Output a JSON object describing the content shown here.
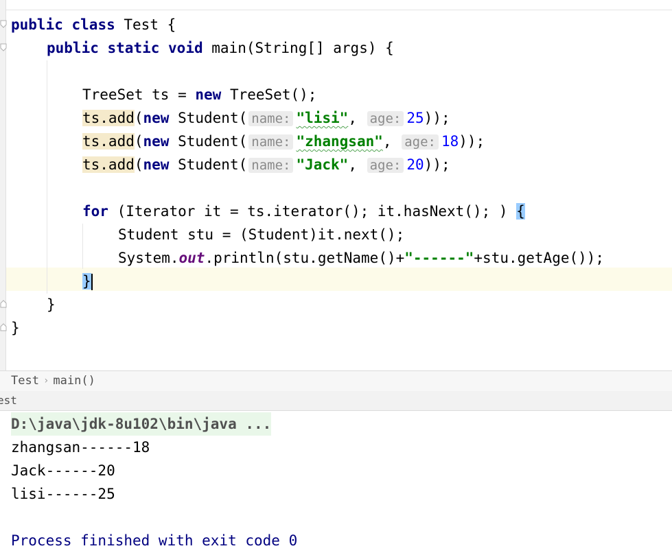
{
  "editor": {
    "l1": {
      "kw1": "public",
      "kw2": "class",
      "name": "Test {"
    },
    "l2": {
      "kw1": "public",
      "kw2": "static",
      "kw3": "void",
      "rest": "main(String[] args) {"
    },
    "l4": {
      "a": "TreeSet ts = ",
      "kw": "new",
      "b": " TreeSet();"
    },
    "adds": [
      {
        "ts": "ts.add",
        "open": "(",
        "kw": "new",
        "cls": " Student(",
        "hint_name": "name:",
        "name": "\"lisi\"",
        "comma": ", ",
        "hint_age": "age:",
        "age": "25",
        "close": "));"
      },
      {
        "ts": "ts.add",
        "open": "(",
        "kw": "new",
        "cls": " Student(",
        "hint_name": "name:",
        "name": "\"zhangsan\"",
        "comma": ", ",
        "hint_age": "age:",
        "age": "18",
        "close": "));"
      },
      {
        "ts": "ts.add",
        "open": "(",
        "kw": "new",
        "cls": " Student(",
        "hint_name": "name:",
        "name": "\"Jack\"",
        "comma": ", ",
        "hint_age": "age:",
        "age": "20",
        "close": "));"
      }
    ],
    "l9": {
      "kw": "for",
      "rest": " (Iterator it = ts.iterator(); it.hasNext(); ) ",
      "brace": "{"
    },
    "l10": {
      "text": "Student stu = (Student)it.next();"
    },
    "l11": {
      "a": "System.",
      "field": "out",
      "b": ".println(stu.getName()+",
      "str": "\"------\"",
      "c": "+stu.getAge());"
    },
    "l12": {
      "brace": "}"
    },
    "l13": {
      "text": "}"
    },
    "l14": {
      "text": "}"
    }
  },
  "breadcrumb": {
    "class": "Test",
    "method": "main()"
  },
  "run_tab": {
    "label": "est"
  },
  "console": {
    "command": "D:\\java\\jdk-8u102\\bin\\java ...",
    "output": [
      "zhangsan------18",
      "Jack------20",
      "lisi------25"
    ],
    "finished": "Process finished with exit code 0"
  }
}
